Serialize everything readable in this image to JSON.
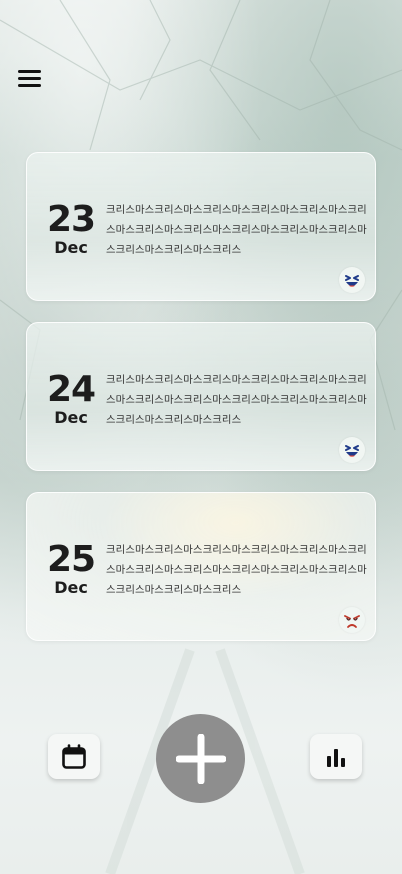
{
  "entries": [
    {
      "day": "23",
      "month": "Dec",
      "text": "크리스마스크리스마스크리스마스크리스마스크리스마스크리스마스크리스마스크리스마스크리스마스크리스마스크리스마스크리스마스크리스마스크리스",
      "mood_icon": "laughing-face-icon"
    },
    {
      "day": "24",
      "month": "Dec",
      "text": "크리스마스크리스마스크리스마스크리스마스크리스마스크리스마스크리스마스크리스마스크리스마스크리스마스크리스마스크리스마스크리스마스크리스",
      "mood_icon": "laughing-face-icon"
    },
    {
      "day": "25",
      "month": "Dec",
      "text": "크리스마스크리스마스크리스마스크리스마스크리스마스크리스마스크리스마스크리스마스크리스마스크리스마스크리스마스크리스마스크리스마스크리스",
      "mood_icon": "angry-face-icon"
    }
  ],
  "toolbar": {
    "calendar_icon": "calendar-icon",
    "add_icon": "plus-icon",
    "stats_icon": "bar-chart-icon"
  },
  "header": {
    "menu_icon": "hamburger-menu-icon"
  },
  "colors": {
    "add_button": "#8e8e8e",
    "laughing_face": "#1f3a8a",
    "angry_face": "#c0392b"
  }
}
